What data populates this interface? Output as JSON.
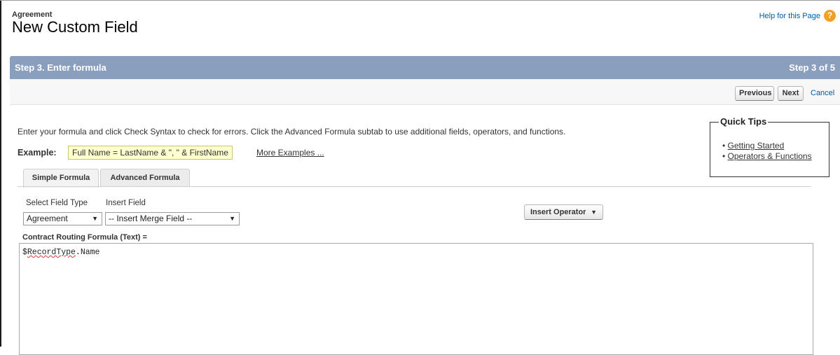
{
  "header": {
    "object_name": "Agreement",
    "title": "New Custom Field",
    "help_link": "Help for this Page",
    "help_icon": "?"
  },
  "step_bar": {
    "title": "Step 3. Enter formula",
    "counter": "Step 3 of 5"
  },
  "toolbar": {
    "previous_label": "Previous",
    "next_label": "Next",
    "cancel_label": "Cancel"
  },
  "intro": "Enter your formula and click Check Syntax to check for errors. Click the Advanced Formula subtab to use additional fields, operators, and functions.",
  "example": {
    "label": "Example:",
    "formula": "Full Name = LastName & \", \" & FirstName",
    "more_link": "More Examples ..."
  },
  "quick_tips": {
    "title": "Quick Tips",
    "items": [
      "Getting Started",
      "Operators & Functions"
    ]
  },
  "tabs": [
    {
      "label": "Simple Formula",
      "active": true
    },
    {
      "label": "Advanced Formula",
      "active": false
    }
  ],
  "field_type": {
    "label": "Select Field Type",
    "selected": "Agreement"
  },
  "insert_field": {
    "label": "Insert Field",
    "selected": "-- Insert Merge Field --"
  },
  "insert_operator": {
    "label": "Insert Operator"
  },
  "formula_editor": {
    "label": "Contract Routing Formula (Text) =",
    "value_prefix": "$",
    "value_misspelled": "RecordType",
    "value_suffix": ".Name"
  },
  "colors": {
    "step_bar": "#8a9ebe",
    "link": "#015ba7",
    "help_icon": "#f29f24",
    "example_highlight": "#ffffd0"
  }
}
